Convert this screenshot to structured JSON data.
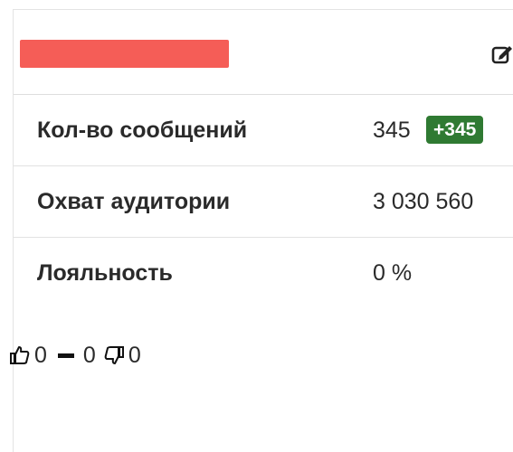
{
  "colors": {
    "title_bar": "#f55d57",
    "delta_badge": "#2f7a32"
  },
  "header": {
    "edit_icon": "edit-icon"
  },
  "stats": [
    {
      "label": "Кол-во сообщений",
      "value": "345",
      "delta": "+345"
    },
    {
      "label": "Охват аудитории",
      "value": "3 030 560"
    },
    {
      "label": "Лояльность",
      "value": "0 %"
    }
  ],
  "reactions": {
    "likes": "0",
    "neutral": "0",
    "dislikes": "0",
    "icons": [
      "thumbs-up-icon",
      "neutral-dash-icon",
      "thumbs-down-icon"
    ]
  }
}
